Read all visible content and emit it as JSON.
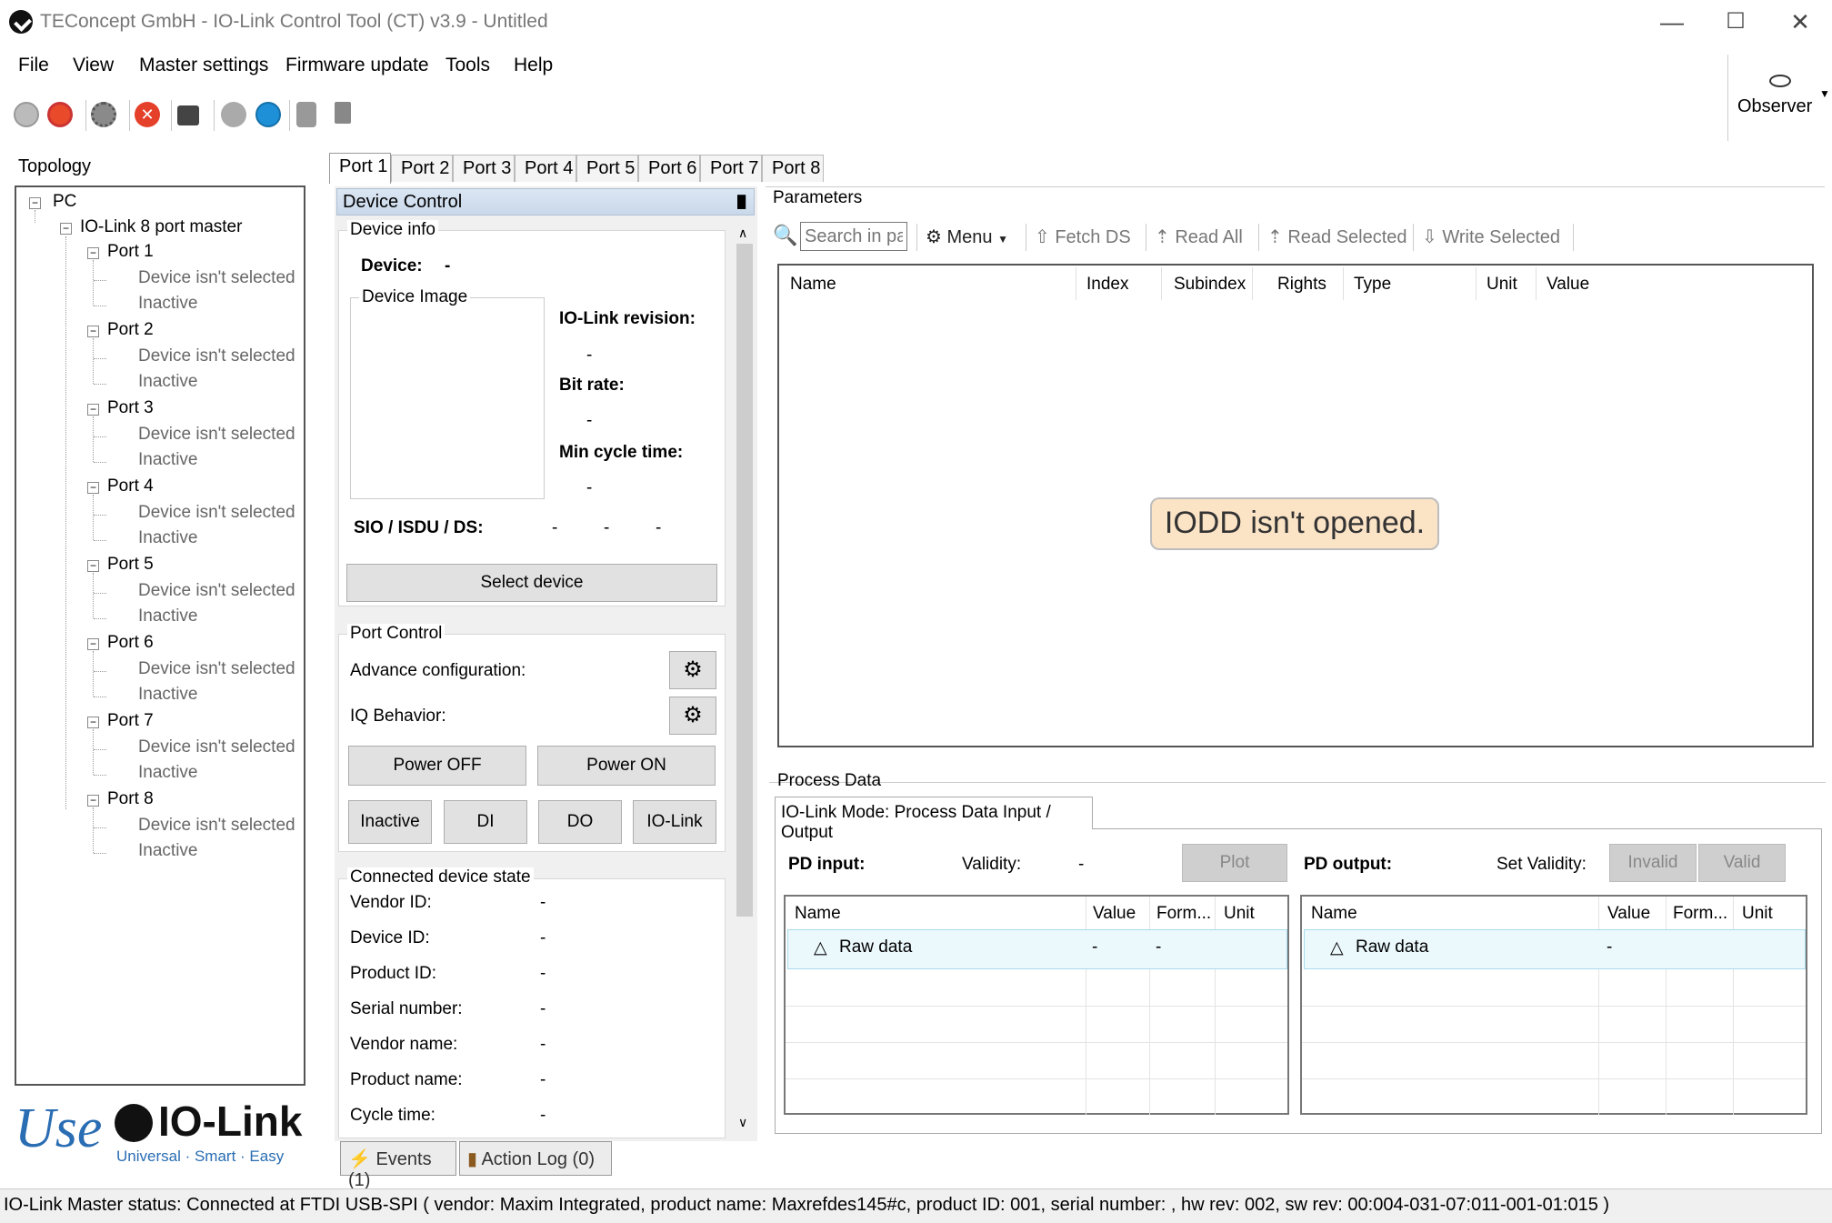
{
  "window": {
    "title": "TEConcept GmbH - IO-Link Control Tool (CT) v3.9 - Untitled",
    "minimize": "—",
    "maximize": "☐",
    "close": "✕"
  },
  "menu": [
    "File",
    "View",
    "Master settings",
    "Firmware update",
    "Tools",
    "Help"
  ],
  "observer": {
    "label": "Observer"
  },
  "topology": {
    "label": "Topology",
    "root": "PC",
    "master": "IO-Link 8 port master",
    "ports": [
      {
        "name": "Port 1",
        "device": "Device isn't selected",
        "state": "Inactive"
      },
      {
        "name": "Port 2",
        "device": "Device isn't selected",
        "state": "Inactive"
      },
      {
        "name": "Port 3",
        "device": "Device isn't selected",
        "state": "Inactive"
      },
      {
        "name": "Port 4",
        "device": "Device isn't selected",
        "state": "Inactive"
      },
      {
        "name": "Port 5",
        "device": "Device isn't selected",
        "state": "Inactive"
      },
      {
        "name": "Port 6",
        "device": "Device isn't selected",
        "state": "Inactive"
      },
      {
        "name": "Port 7",
        "device": "Device isn't selected",
        "state": "Inactive"
      },
      {
        "name": "Port 8",
        "device": "Device isn't selected",
        "state": "Inactive"
      }
    ]
  },
  "logo": {
    "use": "Use",
    "brand": "IO-Link",
    "tagline": "Universal · Smart · Easy"
  },
  "port_tabs": [
    "Port 1",
    "Port 2",
    "Port 3",
    "Port 4",
    "Port 5",
    "Port 6",
    "Port 7",
    "Port 8"
  ],
  "device_control": {
    "header": "Device Control",
    "pin": "█",
    "device_info": {
      "title": "Device info",
      "device_label": "Device:",
      "device_value": "-",
      "image_label": "Device Image",
      "revision_label": "IO-Link revision:",
      "revision_value": "-",
      "bitrate_label": "Bit rate:",
      "bitrate_value": "-",
      "cycle_label": "Min cycle time:",
      "cycle_value": "-",
      "sio_label": "SIO / ISDU / DS:",
      "sio_values": [
        "-",
        "-",
        "-"
      ],
      "select_button": "Select device"
    },
    "port_control": {
      "title": "Port Control",
      "advance_label": "Advance configuration:",
      "iq_label": "IQ Behavior:",
      "power_off": "Power OFF",
      "power_on": "Power ON",
      "modes": [
        "Inactive",
        "DI",
        "DO",
        "IO-Link"
      ]
    },
    "connected_state": {
      "title": "Connected device state",
      "rows": [
        {
          "label": "Vendor ID:",
          "value": "-"
        },
        {
          "label": "Device ID:",
          "value": "-"
        },
        {
          "label": "Product ID:",
          "value": "-"
        },
        {
          "label": "Serial number:",
          "value": "-"
        },
        {
          "label": "Vendor name:",
          "value": "-"
        },
        {
          "label": "Product name:",
          "value": "-"
        },
        {
          "label": "Cycle time:",
          "value": "-"
        }
      ]
    }
  },
  "bottom_tabs": {
    "events": "Events (1)",
    "action_log": "Action Log (0)"
  },
  "parameters": {
    "title": "Parameters",
    "search_placeholder": "Search in parameters",
    "menu": "Menu",
    "fetch_ds": "Fetch DS",
    "read_all": "Read All",
    "read_selected": "Read Selected",
    "write_selected": "Write Selected",
    "columns": [
      "Name",
      "Index",
      "Subindex",
      "Rights",
      "Type",
      "Unit",
      "Value"
    ],
    "empty_message": "IODD isn't opened."
  },
  "process_data": {
    "title": "Process Data",
    "tab": "IO-Link Mode: Process Data Input / Output",
    "pd_input": "PD input:",
    "validity_label": "Validity:",
    "validity_value": "-",
    "plot": "Plot",
    "pd_output": "PD output:",
    "set_validity": "Set Validity:",
    "invalid": "Invalid",
    "valid": "Valid",
    "input_columns": [
      "Name",
      "Value",
      "Form...",
      "Unit"
    ],
    "input_row": {
      "name": "Raw data",
      "value": "-",
      "format": "-"
    },
    "output_columns": [
      "Name",
      "Value",
      "Form...",
      "Unit"
    ],
    "output_row": {
      "name": "Raw data",
      "value": "-"
    }
  },
  "status": {
    "text": "IO-Link Master status:   Connected at FTDI USB-SPI     ( vendor: Maxim Integrated, product name: Maxrefdes145#c, product ID: 001, serial number: , hw rev: 002, sw rev: 00:004-031-07:011-001-01:015 )"
  }
}
